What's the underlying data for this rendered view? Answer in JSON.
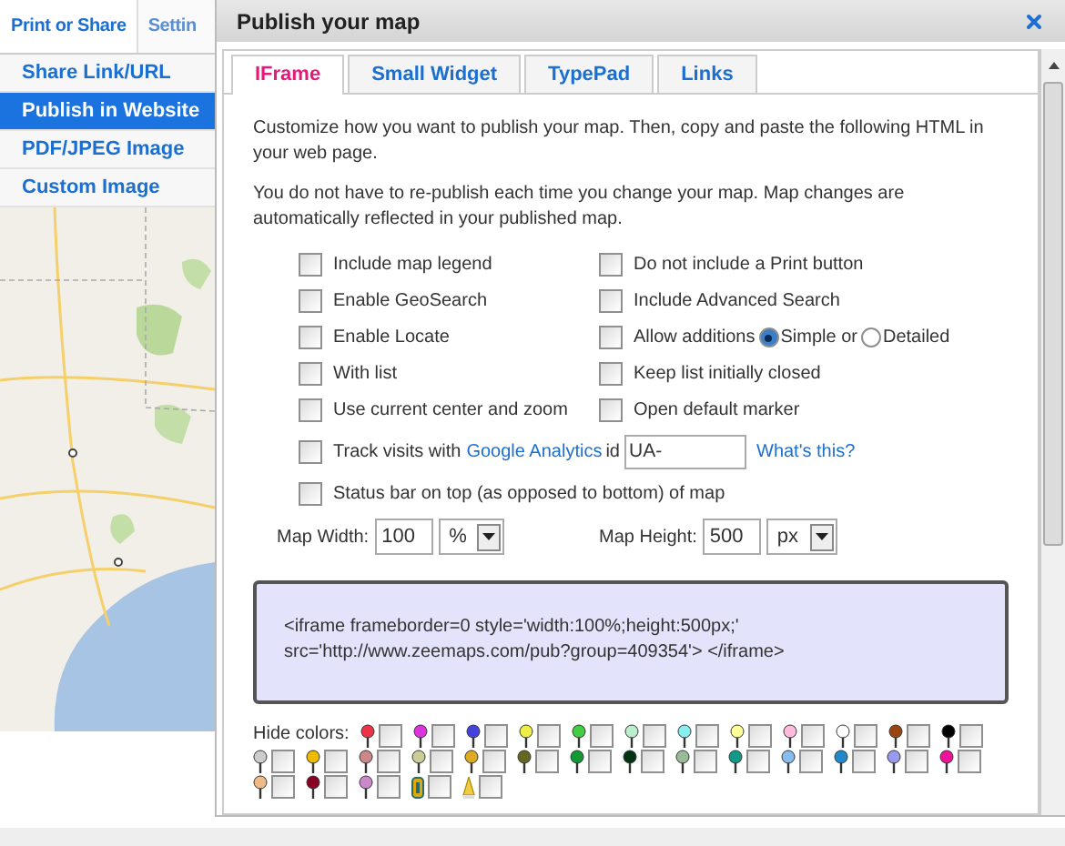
{
  "sidebar": {
    "tabs": [
      {
        "label": "Print or Share",
        "selected": true
      },
      {
        "label": "Settin",
        "selected": false
      }
    ],
    "items": [
      {
        "label": "Share Link/URL",
        "selected": false
      },
      {
        "label": "Publish in Website",
        "selected": true
      },
      {
        "label": "PDF/JPEG Image",
        "selected": false
      },
      {
        "label": "Custom Image",
        "selected": false
      }
    ]
  },
  "dialog": {
    "title": "Publish your map",
    "tabs": [
      {
        "label": "IFrame",
        "selected": true
      },
      {
        "label": "Small Widget",
        "selected": false
      },
      {
        "label": "TypePad",
        "selected": false
      },
      {
        "label": "Links",
        "selected": false
      }
    ],
    "intro": [
      "Customize how you want to publish your map. Then, copy and paste the following HTML in your web page.",
      "You do not have to re-publish each time you change your map. Map changes are automatically reflected in your published map."
    ],
    "left_options": [
      {
        "label": "Include map legend",
        "checked": false
      },
      {
        "label": "Enable GeoSearch",
        "checked": false
      },
      {
        "label": "Enable Locate",
        "checked": false
      },
      {
        "label": "With list",
        "checked": false
      },
      {
        "label": "Use current center and zoom",
        "checked": false
      }
    ],
    "right_options": [
      {
        "label": "Do not include a Print button",
        "checked": false
      },
      {
        "label": "Include Advanced Search",
        "checked": false
      },
      {
        "label": "Allow additions",
        "checked": false,
        "radios": [
          {
            "label": "Simple or",
            "selected": true
          },
          {
            "label": "Detailed",
            "selected": false
          }
        ]
      },
      {
        "label": "Keep list initially closed",
        "checked": false
      },
      {
        "label": "Open default marker",
        "checked": false
      }
    ],
    "analytics": {
      "checked": false,
      "before": "Track visits with",
      "link": "Google Analytics",
      "after": "id",
      "value": "UA-",
      "help": "What's this?"
    },
    "status_bar_option": {
      "label": "Status bar on top (as opposed to bottom) of map",
      "checked": false
    },
    "map_width": {
      "label": "Map Width:",
      "value": "100",
      "unit": "%"
    },
    "map_height": {
      "label": "Map Height:",
      "value": "500",
      "unit": "px"
    },
    "code": [
      "<iframe frameborder=0 style='width:100%;height:500px;'",
      "src='http://www.zeemaps.com/pub?group=409354'> </iframe>"
    ],
    "hide_colors": {
      "label": "Hide colors:",
      "pins": [
        {
          "kind": "pin",
          "color": "#ee3344",
          "checked": false
        },
        {
          "kind": "pin",
          "color": "#dd33dd",
          "checked": false
        },
        {
          "kind": "pin",
          "color": "#4444dd",
          "checked": false
        },
        {
          "kind": "pin",
          "color": "#eeee44",
          "checked": false
        },
        {
          "kind": "pin",
          "color": "#44cc44",
          "checked": false
        },
        {
          "kind": "pin",
          "color": "#bbeecc",
          "checked": false
        },
        {
          "kind": "pin",
          "color": "#88eeee",
          "checked": false
        },
        {
          "kind": "pin",
          "color": "#ffff99",
          "checked": false
        },
        {
          "kind": "pin",
          "color": "#ffbbdd",
          "checked": false
        },
        {
          "kind": "pin",
          "color": "#ffffff",
          "checked": false
        },
        {
          "kind": "pin",
          "color": "#994411",
          "checked": false
        },
        {
          "kind": "pin",
          "color": "#000000",
          "checked": false
        },
        {
          "kind": "pin",
          "color": "#cccccc",
          "checked": false
        },
        {
          "kind": "pin",
          "color": "#eebb00",
          "checked": false
        },
        {
          "kind": "pin",
          "color": "#cc8888",
          "checked": false
        },
        {
          "kind": "pin",
          "color": "#cccc99",
          "checked": false
        },
        {
          "kind": "pin",
          "color": "#ddaa22",
          "checked": false
        },
        {
          "kind": "pin",
          "color": "#666622",
          "checked": false
        },
        {
          "kind": "pin",
          "color": "#119933",
          "checked": false
        },
        {
          "kind": "pin",
          "color": "#003311",
          "checked": false
        },
        {
          "kind": "pin",
          "color": "#99bb99",
          "checked": false
        },
        {
          "kind": "pin",
          "color": "#119988",
          "checked": false
        },
        {
          "kind": "pin",
          "color": "#88bbee",
          "checked": false
        },
        {
          "kind": "pin",
          "color": "#2288cc",
          "checked": false
        },
        {
          "kind": "pin",
          "color": "#9999ee",
          "checked": false
        },
        {
          "kind": "pin",
          "color": "#ee1199",
          "checked": false
        },
        {
          "kind": "pin",
          "color": "#eebb88",
          "checked": false
        },
        {
          "kind": "pin",
          "color": "#880022",
          "checked": false
        },
        {
          "kind": "pin",
          "color": "#cc88cc",
          "checked": false
        },
        {
          "kind": "tag",
          "color": "#ddaa11",
          "checked": false
        },
        {
          "kind": "spike",
          "color": "#eecc44",
          "checked": false
        }
      ]
    }
  }
}
